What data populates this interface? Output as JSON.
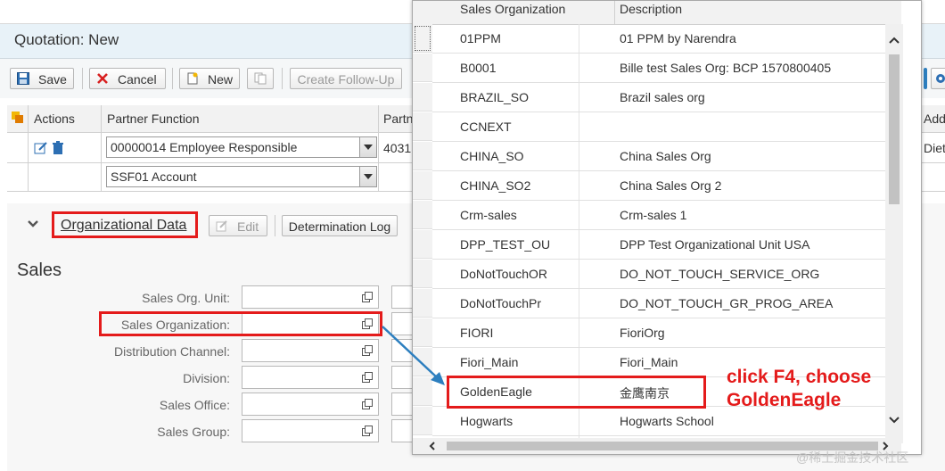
{
  "app": {
    "title": "Quotation: New"
  },
  "toolbar": {
    "save": "Save",
    "cancel": "Cancel",
    "new": "New",
    "create_follow_up": "Create Follow-Up"
  },
  "partner_table": {
    "headers": [
      "Actions",
      "Partner Function",
      "Partn",
      "Add"
    ],
    "rows": [
      {
        "function": "00000014 Employee Responsible",
        "partner": "4031",
        "addr": "Diet"
      },
      {
        "function": "SSF01 Account",
        "partner": "",
        "addr": ""
      }
    ]
  },
  "org_section": {
    "title": "Organizational Data",
    "edit": "Edit",
    "determination_log": "Determination Log",
    "sales_heading": "Sales",
    "fields": [
      {
        "label": "Sales Org. Unit:",
        "value": ""
      },
      {
        "label": "Sales Organization:",
        "value": ""
      },
      {
        "label": "Distribution Channel:",
        "value": ""
      },
      {
        "label": "Division:",
        "value": ""
      },
      {
        "label": "Sales Office:",
        "value": ""
      },
      {
        "label": "Sales Group:",
        "value": ""
      }
    ]
  },
  "popup": {
    "headers": [
      "Sales Organization",
      "Description"
    ],
    "rows": [
      {
        "org": "01PPM",
        "desc": "01 PPM by Narendra"
      },
      {
        "org": "B0001",
        "desc": "Bille test Sales Org: BCP 1570800405"
      },
      {
        "org": "BRAZIL_SO",
        "desc": "Brazil sales org"
      },
      {
        "org": "CCNEXT",
        "desc": ""
      },
      {
        "org": "CHINA_SO",
        "desc": "China Sales Org"
      },
      {
        "org": "CHINA_SO2",
        "desc": "China Sales Org 2"
      },
      {
        "org": "Crm-sales",
        "desc": "Crm-sales 1"
      },
      {
        "org": "DPP_TEST_OU",
        "desc": "DPP Test Organizational Unit USA"
      },
      {
        "org": "DoNotTouchOR",
        "desc": "DO_NOT_TOUCH_SERVICE_ORG"
      },
      {
        "org": "DoNotTouchPr",
        "desc": "DO_NOT_TOUCH_GR_PROG_AREA"
      },
      {
        "org": "FIORI",
        "desc": "FioriOrg"
      },
      {
        "org": "Fiori_Main",
        "desc": "Fiori_Main"
      },
      {
        "org": "GoldenEagle",
        "desc": "金鹰南京"
      },
      {
        "org": "Hogwarts",
        "desc": "Hogwarts School"
      }
    ]
  },
  "annotation": {
    "line1": "click F4, choose",
    "line2": "GoldenEagle"
  },
  "watermark": "@稀土掘金技术社区",
  "colors": {
    "highlight_red": "#e41b1b",
    "arrow_blue": "#2d7fbf",
    "title_bg": "#e8f2f8"
  }
}
